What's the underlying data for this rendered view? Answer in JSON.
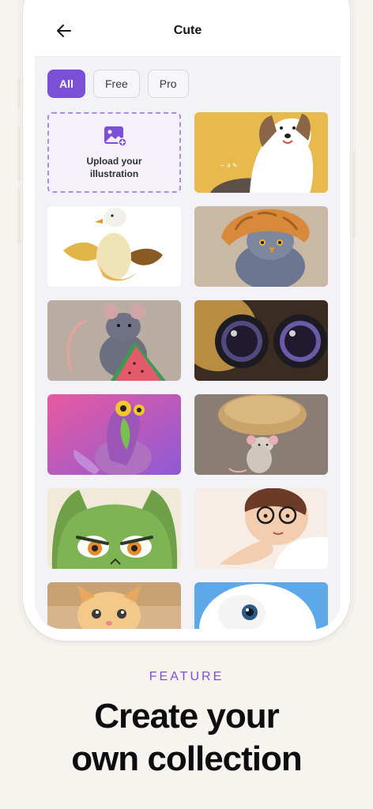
{
  "screen": {
    "title": "Cute",
    "filters": [
      {
        "label": "All",
        "active": true
      },
      {
        "label": "Free",
        "active": false
      },
      {
        "label": "Pro",
        "active": false
      }
    ],
    "upload_tile": {
      "label": "Upload your illustration",
      "icon": "image-add-icon"
    },
    "images": [
      {
        "name": "dog-illustration",
        "bg": "#e8b94c"
      },
      {
        "name": "duck-banana-illustration",
        "bg": "#ffffff"
      },
      {
        "name": "pigeon-croissant-illustration",
        "bg": "#c9b8a4"
      },
      {
        "name": "mouse-watermelon-illustration",
        "bg": "#b9aca0"
      },
      {
        "name": "cat-eyes-illustration",
        "bg": "#3a2c20"
      },
      {
        "name": "bird-pink-illustration",
        "bg": "#d7559a"
      },
      {
        "name": "mouse-bread-illustration",
        "bg": "#8a7d74"
      },
      {
        "name": "green-cat-illustration",
        "bg": "#f1ead8"
      },
      {
        "name": "boy-glasses-illustration",
        "bg": "#f6eee6"
      },
      {
        "name": "kitten-box-illustration",
        "bg": "#d7b48a"
      },
      {
        "name": "white-cat-illustration",
        "bg": "#5da8e8"
      }
    ]
  },
  "caption": {
    "feature": "FEATURE",
    "headline_line1": "Create your",
    "headline_line2": "own collection"
  },
  "colors": {
    "accent": "#7b4fd6",
    "background": "#f7f4ef"
  }
}
